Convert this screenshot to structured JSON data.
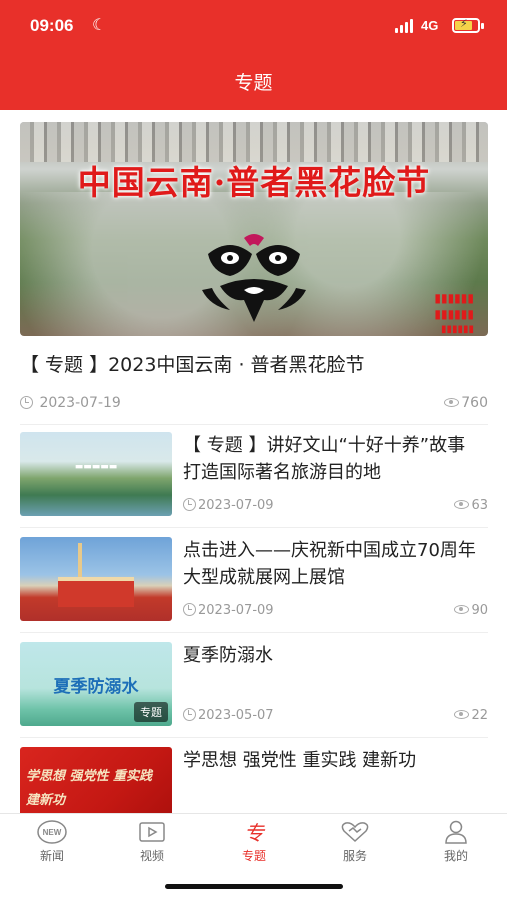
{
  "status_bar": {
    "time": "09:06",
    "network": "4G"
  },
  "header": {
    "title": "专题"
  },
  "hero": {
    "image_text": "中国云南·普者黑花脸节",
    "title": "【 专题 】2023中国云南 · 普者黑花脸节",
    "date": "2023-07-19",
    "views": "760"
  },
  "items": [
    {
      "title": "【 专题 】讲好文山“十好十养”故事 打造国际著名旅游目的地",
      "date": "2023-07-09",
      "views": "63"
    },
    {
      "title": "点击进入——庆祝新中国成立70周年大型成就展网上展馆",
      "date": "2023-07-09",
      "views": "90"
    },
    {
      "title": "夏季防溺水",
      "date": "2023-05-07",
      "views": "22",
      "thumb_text": "夏季防溺水",
      "thumb_tag": "专题"
    },
    {
      "title": "学思想 强党性 重实践 建新功",
      "thumb_text": "学思想 强党性 重实践 建新功"
    }
  ],
  "bottom_nav": [
    {
      "label": "新闻",
      "icon": "news-icon"
    },
    {
      "label": "视频",
      "icon": "video-icon"
    },
    {
      "label": "专题",
      "icon": "topic-icon",
      "active": true
    },
    {
      "label": "服务",
      "icon": "service-icon"
    },
    {
      "label": "我的",
      "icon": "profile-icon"
    }
  ],
  "colors": {
    "accent": "#e8302a",
    "meta_text": "#999999",
    "title_text": "#222222"
  }
}
